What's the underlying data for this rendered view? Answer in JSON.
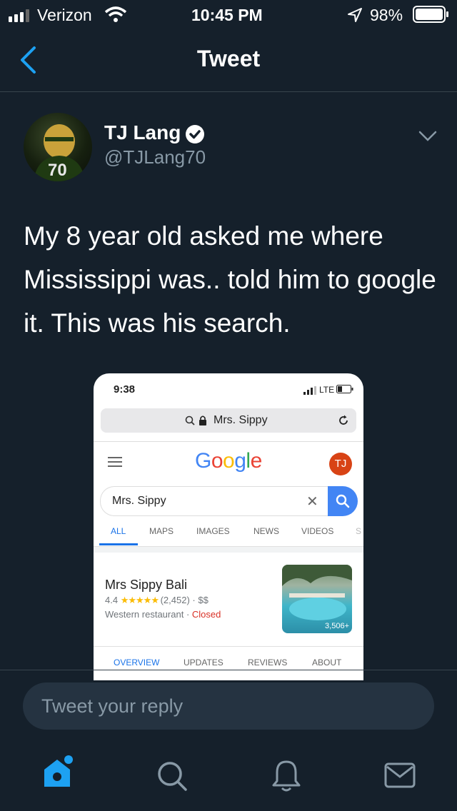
{
  "status": {
    "carrier": "Verizon",
    "time": "10:45 PM",
    "battery": "98%"
  },
  "nav": {
    "title": "Tweet"
  },
  "tweet": {
    "name": "TJ Lang",
    "handle": "@TJLang70",
    "jersey": "70",
    "text": "My 8 year old asked me where Mississippi was.. told him to google it.  This was his search."
  },
  "embedded": {
    "time": "9:38",
    "network": "LTE",
    "url": "Mrs. Sippy",
    "logo": [
      {
        "ch": "G",
        "color": "#4285f4"
      },
      {
        "ch": "o",
        "color": "#ea4335"
      },
      {
        "ch": "o",
        "color": "#fbbc05"
      },
      {
        "ch": "g",
        "color": "#4285f4"
      },
      {
        "ch": "l",
        "color": "#34a853"
      },
      {
        "ch": "e",
        "color": "#ea4335"
      }
    ],
    "profile": "TJ",
    "query": "Mrs. Sippy",
    "tabs": [
      "ALL",
      "MAPS",
      "IMAGES",
      "NEWS",
      "VIDEOS",
      "S"
    ],
    "result": {
      "title": "Mrs Sippy Bali",
      "rating": "4.4",
      "stars": 4.4,
      "reviews": "(2,452)",
      "price": "$$",
      "category": "Western restaurant",
      "status": "Closed",
      "photo_count": "3,506+"
    },
    "bottom_tabs": [
      "OVERVIEW",
      "UPDATES",
      "REVIEWS",
      "ABOUT"
    ]
  },
  "reply": {
    "placeholder": "Tweet your reply"
  },
  "colors": {
    "bg": "#15202b",
    "accent": "#1da1f2",
    "muted": "#8899a6",
    "border": "#38444d"
  },
  "icons": [
    "signal-icon",
    "wifi-icon",
    "location-icon",
    "battery-icon",
    "back-chevron-icon",
    "verified-badge-icon",
    "chevron-down-icon",
    "home-icon",
    "search-icon",
    "bell-icon",
    "mail-icon"
  ]
}
